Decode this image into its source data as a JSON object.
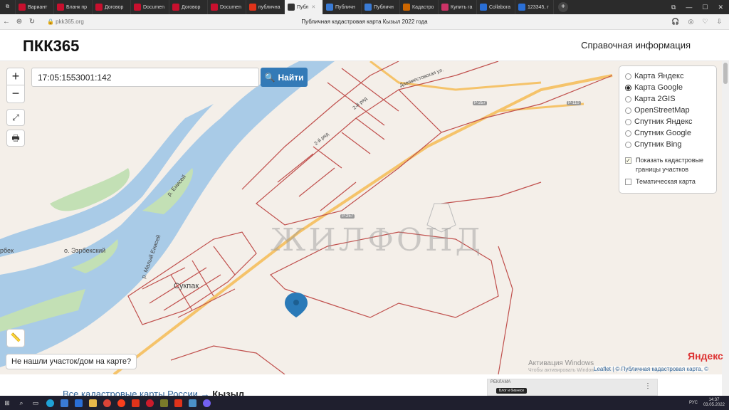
{
  "tabs": [
    {
      "label": "Вариант",
      "color": "#c8102e",
      "icon": "uk-icon"
    },
    {
      "label": "Бланк пр",
      "color": "#c8102e",
      "icon": "uk-icon"
    },
    {
      "label": "Договор",
      "color": "#c8102e",
      "icon": "uk-icon"
    },
    {
      "label": "Documen",
      "color": "#c8102e",
      "icon": "uk-icon"
    },
    {
      "label": "Договор",
      "color": "#c8102e",
      "icon": "uk-icon"
    },
    {
      "label": "Documen",
      "color": "#c8102e",
      "icon": "uk-icon"
    },
    {
      "label": "публична",
      "color": "#e0331a",
      "icon": "yandex-icon"
    },
    {
      "label": "Публ",
      "color": "#333",
      "icon": "map-pin-icon",
      "active": true
    },
    {
      "label": "Публичн",
      "color": "#3a7bd5",
      "icon": "map-icon"
    },
    {
      "label": "Публичн",
      "color": "#3a7bd5",
      "icon": "map-icon"
    },
    {
      "label": "Кадастро",
      "color": "#cc6600",
      "icon": "cadastre-icon"
    },
    {
      "label": "Купить га",
      "color": "#cc3366",
      "icon": "avito-icon"
    },
    {
      "label": "Collabora",
      "color": "#2a6fd6",
      "icon": "chrome-icon"
    },
    {
      "label": "123345, г",
      "color": "#2a6fd6",
      "icon": "chrome-icon"
    }
  ],
  "address": {
    "url": "pkk365.org",
    "title": "Публичная кадастровая карта Кызыл 2022 года"
  },
  "header": {
    "logo": "ПКК365",
    "help": "Справочная информация"
  },
  "search": {
    "value": "17:05:1553001:142",
    "button": "Найти"
  },
  "zoom": {
    "plus": "+",
    "minus": "−"
  },
  "layers": {
    "options": [
      {
        "label": "Карта Яндекс",
        "selected": false
      },
      {
        "label": "Карта Google",
        "selected": true
      },
      {
        "label": "Карта 2GIS",
        "selected": false
      },
      {
        "label": "OpenStreetMap",
        "selected": false
      },
      {
        "label": "Спутник Яндекс",
        "selected": false
      },
      {
        "label": "Спутник Google",
        "selected": false
      },
      {
        "label": "Спутник Bing",
        "selected": false
      }
    ],
    "show_borders": "Показать кадастровые границы участков",
    "show_borders_checked": true,
    "thematic": "Тематическая карта",
    "thematic_checked": false
  },
  "map_labels": {
    "watermark": "ЖИЛФОНД",
    "place_sukpak": "Сукпак",
    "island": "о. Эзрбекский",
    "river": "р. Енисей",
    "river2": "р. Малый Енисей",
    "edge": "рбек",
    "road1": "Р-257",
    "road2": "Р-257",
    "road3": "Р-257",
    "road4": "Р-110",
    "street": "Даваместовская ул.",
    "street2": "2-й ряд",
    "street3": "2-й ряд"
  },
  "notfound": "Не нашли участок/дом на карте?",
  "windows_activation": {
    "line1": "Активация Windows",
    "line2": "Чтобы активировать Windows, перейдите в раздел «Параметры»."
  },
  "yandex_logo": "Яндекс",
  "attribution": "Leaflet | © Публичная кадастровая карта, ©",
  "breadcrumb": {
    "link": "Все кадастровые карты России",
    "sep": "→",
    "current": "Кызыл"
  },
  "ad": {
    "label": "РЕКЛАМА",
    "button": "Блог и бизнесе"
  },
  "taskbar": {
    "lang": "РУС",
    "time": "14:37",
    "date": "03.05.2022"
  }
}
